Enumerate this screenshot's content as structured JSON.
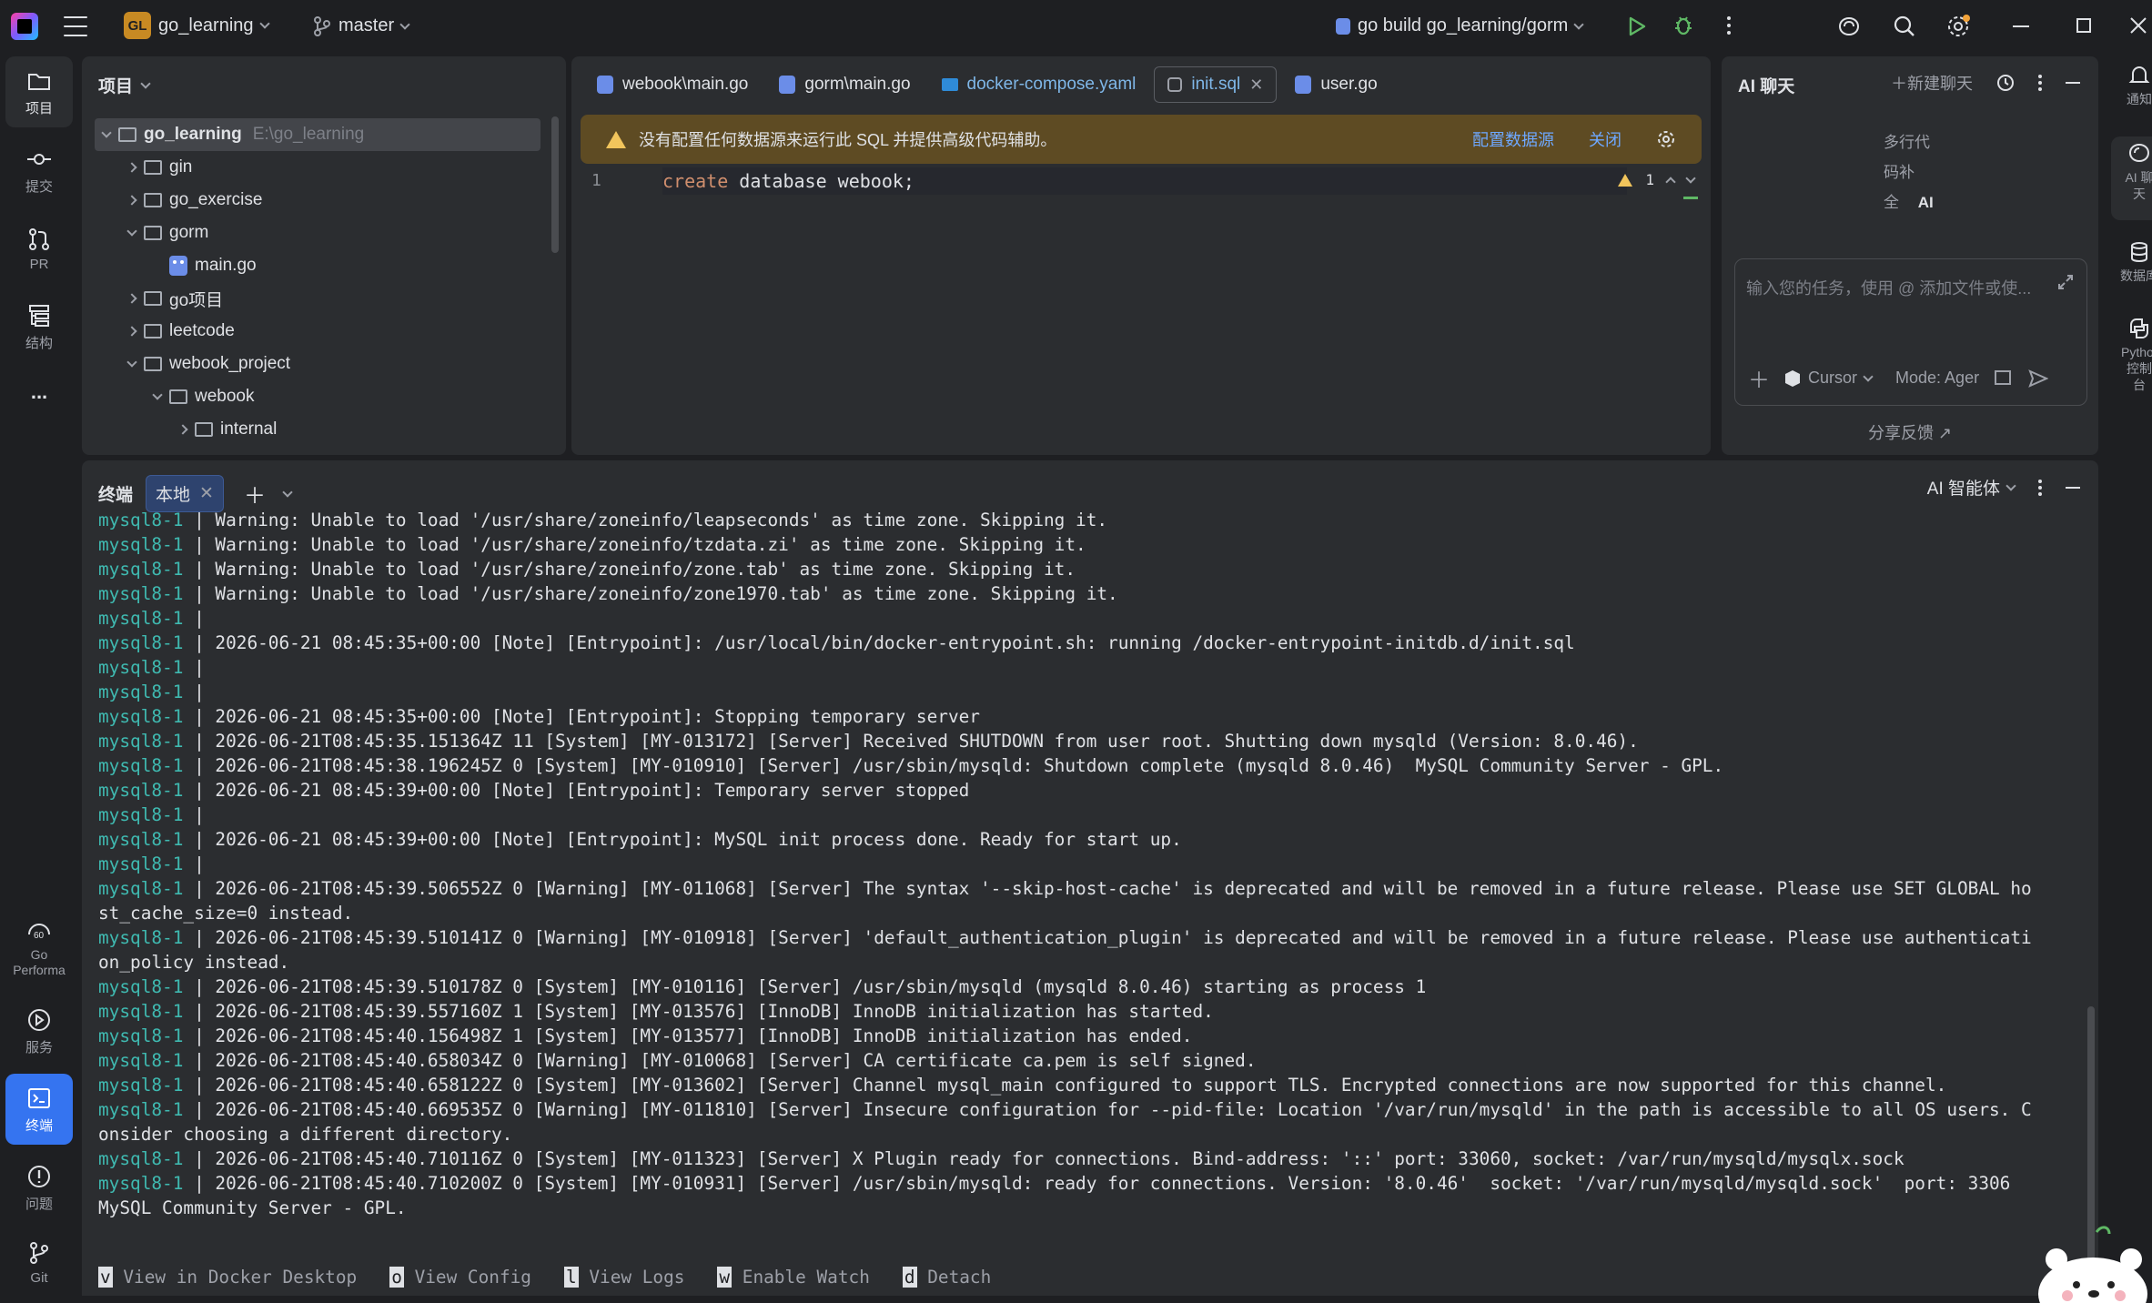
{
  "titlebar": {
    "project_badge": "GL",
    "project_name": "go_learning",
    "branch": "master",
    "run_config": "go build go_learning/gorm"
  },
  "leftbar": {
    "items": [
      {
        "label": "项目",
        "icon": "folder-icon"
      },
      {
        "label": "提交",
        "icon": "commit-icon"
      },
      {
        "label": "PR",
        "icon": "pull-request-icon"
      },
      {
        "label": "结构",
        "icon": "structure-icon"
      },
      {
        "label": "...",
        "icon": "more-icon"
      }
    ],
    "bottom_items": [
      {
        "label": "Go Performa",
        "icon": "go-performance-icon"
      },
      {
        "label": "服务",
        "icon": "services-icon"
      },
      {
        "label": "终端",
        "icon": "terminal-icon"
      },
      {
        "label": "问题",
        "icon": "problems-icon"
      },
      {
        "label": "Git",
        "icon": "git-icon"
      }
    ]
  },
  "rightbar": {
    "items": [
      {
        "label": "通知",
        "icon": "bell-icon"
      },
      {
        "label": "AI 聊天",
        "icon": "ai-chat-icon"
      },
      {
        "label": "数据库",
        "icon": "database-icon"
      },
      {
        "label": "Python 控制台",
        "icon": "python-icon"
      }
    ]
  },
  "project_panel": {
    "title": "项目",
    "tree": [
      {
        "label": "go_learning",
        "path": "E:\\go_learning",
        "depth": 0,
        "type": "root",
        "open": true
      },
      {
        "label": "gin",
        "depth": 1,
        "type": "folder",
        "open": false
      },
      {
        "label": "go_exercise",
        "depth": 1,
        "type": "folder",
        "open": false
      },
      {
        "label": "gorm",
        "depth": 1,
        "type": "folder",
        "open": true
      },
      {
        "label": "main.go",
        "depth": 2,
        "type": "file"
      },
      {
        "label": "go项目",
        "depth": 1,
        "type": "folder",
        "open": false
      },
      {
        "label": "leetcode",
        "depth": 1,
        "type": "folder",
        "open": false
      },
      {
        "label": "webook_project",
        "depth": 1,
        "type": "folder",
        "open": true
      },
      {
        "label": "webook",
        "depth": 2,
        "type": "folder",
        "open": true
      },
      {
        "label": "internal",
        "depth": 3,
        "type": "folder",
        "open": false
      }
    ]
  },
  "editor": {
    "tabs": [
      {
        "label": "webook\\main.go",
        "icon": "go-file-icon"
      },
      {
        "label": "gorm\\main.go",
        "icon": "go-file-icon"
      },
      {
        "label": "docker-compose.yaml",
        "icon": "docker-icon"
      },
      {
        "label": "init.sql",
        "icon": "sql-file-icon",
        "active": true
      },
      {
        "label": "user.go",
        "icon": "go-file-icon"
      }
    ],
    "banner": {
      "text": "没有配置任何数据源来运行此 SQL 并提供高级代码辅助。",
      "configure": "配置数据源",
      "close": "关闭"
    },
    "line_number": "1",
    "code_keyword": "create",
    "code_rest": " database webook;",
    "warning_count": "1"
  },
  "ai_panel": {
    "title": "AI 聊天",
    "new_chat": "新建聊天",
    "list": [
      "多行代",
      "码补",
      "全"
    ],
    "list_bold": "AI",
    "input_placeholder": "输入您的任务，使用 @ 添加文件或使...",
    "model": "Cursor",
    "mode": "Mode: Ager",
    "feedback": "分享反馈 ↗"
  },
  "terminal": {
    "title": "终端",
    "tab": "本地",
    "agent": "AI 智能体",
    "lines": [
      {
        "p": "mysql8-1",
        "t": " | Warning: Unable to load '/usr/share/zoneinfo/leapseconds' as time zone. Skipping it."
      },
      {
        "p": "mysql8-1",
        "t": " | Warning: Unable to load '/usr/share/zoneinfo/tzdata.zi' as time zone. Skipping it."
      },
      {
        "p": "mysql8-1",
        "t": " | Warning: Unable to load '/usr/share/zoneinfo/zone.tab' as time zone. Skipping it."
      },
      {
        "p": "mysql8-1",
        "t": " | Warning: Unable to load '/usr/share/zoneinfo/zone1970.tab' as time zone. Skipping it."
      },
      {
        "p": "mysql8-1",
        "t": " |"
      },
      {
        "p": "mysql8-1",
        "t": " | 2026-06-21 08:45:35+00:00 [Note] [Entrypoint]: /usr/local/bin/docker-entrypoint.sh: running /docker-entrypoint-initdb.d/init.sql"
      },
      {
        "p": "mysql8-1",
        "t": " |"
      },
      {
        "p": "mysql8-1",
        "t": " |"
      },
      {
        "p": "mysql8-1",
        "t": " | 2026-06-21 08:45:35+00:00 [Note] [Entrypoint]: Stopping temporary server"
      },
      {
        "p": "mysql8-1",
        "t": " | 2026-06-21T08:45:35.151364Z 11 [System] [MY-013172] [Server] Received SHUTDOWN from user root. Shutting down mysqld (Version: 8.0.46)."
      },
      {
        "p": "mysql8-1",
        "t": " | 2026-06-21T08:45:38.196245Z 0 [System] [MY-010910] [Server] /usr/sbin/mysqld: Shutdown complete (mysqld 8.0.46)  MySQL Community Server - GPL."
      },
      {
        "p": "mysql8-1",
        "t": " | 2026-06-21 08:45:39+00:00 [Note] [Entrypoint]: Temporary server stopped"
      },
      {
        "p": "mysql8-1",
        "t": " |"
      },
      {
        "p": "mysql8-1",
        "t": " | 2026-06-21 08:45:39+00:00 [Note] [Entrypoint]: MySQL init process done. Ready for start up."
      },
      {
        "p": "mysql8-1",
        "t": " |"
      },
      {
        "p": "mysql8-1",
        "t": " | 2026-06-21T08:45:39.506552Z 0 [Warning] [MY-011068] [Server] The syntax '--skip-host-cache' is deprecated and will be removed in a future release. Please use SET GLOBAL ho"
      },
      {
        "p": "",
        "t": "st_cache_size=0 instead."
      },
      {
        "p": "mysql8-1",
        "t": " | 2026-06-21T08:45:39.510141Z 0 [Warning] [MY-010918] [Server] 'default_authentication_plugin' is deprecated and will be removed in a future release. Please use authenticati"
      },
      {
        "p": "",
        "t": "on_policy instead."
      },
      {
        "p": "mysql8-1",
        "t": " | 2026-06-21T08:45:39.510178Z 0 [System] [MY-010116] [Server] /usr/sbin/mysqld (mysqld 8.0.46) starting as process 1"
      },
      {
        "p": "mysql8-1",
        "t": " | 2026-06-21T08:45:39.557160Z 1 [System] [MY-013576] [InnoDB] InnoDB initialization has started."
      },
      {
        "p": "mysql8-1",
        "t": " | 2026-06-21T08:45:40.156498Z 1 [System] [MY-013577] [InnoDB] InnoDB initialization has ended."
      },
      {
        "p": "mysql8-1",
        "t": " | 2026-06-21T08:45:40.658034Z 0 [Warning] [MY-010068] [Server] CA certificate ca.pem is self signed."
      },
      {
        "p": "mysql8-1",
        "t": " | 2026-06-21T08:45:40.658122Z 0 [System] [MY-013602] [Server] Channel mysql_main configured to support TLS. Encrypted connections are now supported for this channel."
      },
      {
        "p": "mysql8-1",
        "t": " | 2026-06-21T08:45:40.669535Z 0 [Warning] [MY-011810] [Server] Insecure configuration for --pid-file: Location '/var/run/mysqld' in the path is accessible to all OS users. C"
      },
      {
        "p": "",
        "t": "onsider choosing a different directory."
      },
      {
        "p": "mysql8-1",
        "t": " | 2026-06-21T08:45:40.710116Z 0 [System] [MY-011323] [Server] X Plugin ready for connections. Bind-address: '::' port: 33060, socket: /var/run/mysqld/mysqlx.sock"
      },
      {
        "p": "mysql8-1",
        "t": " | 2026-06-21T08:45:40.710200Z 0 [System] [MY-010931] [Server] /usr/sbin/mysqld: ready for connections. Version: '8.0.46'  socket: '/var/run/mysqld/mysqld.sock'  port: 3306"
      },
      {
        "p": "",
        "t": "MySQL Community Server - GPL."
      }
    ],
    "footer": [
      {
        "key": "v",
        "label": " View in Docker Desktop"
      },
      {
        "key": "o",
        "label": " View Config"
      },
      {
        "key": "l",
        "label": " View Logs"
      },
      {
        "key": "w",
        "label": " Enable Watch"
      },
      {
        "key": "d",
        "label": " Detach"
      }
    ]
  }
}
